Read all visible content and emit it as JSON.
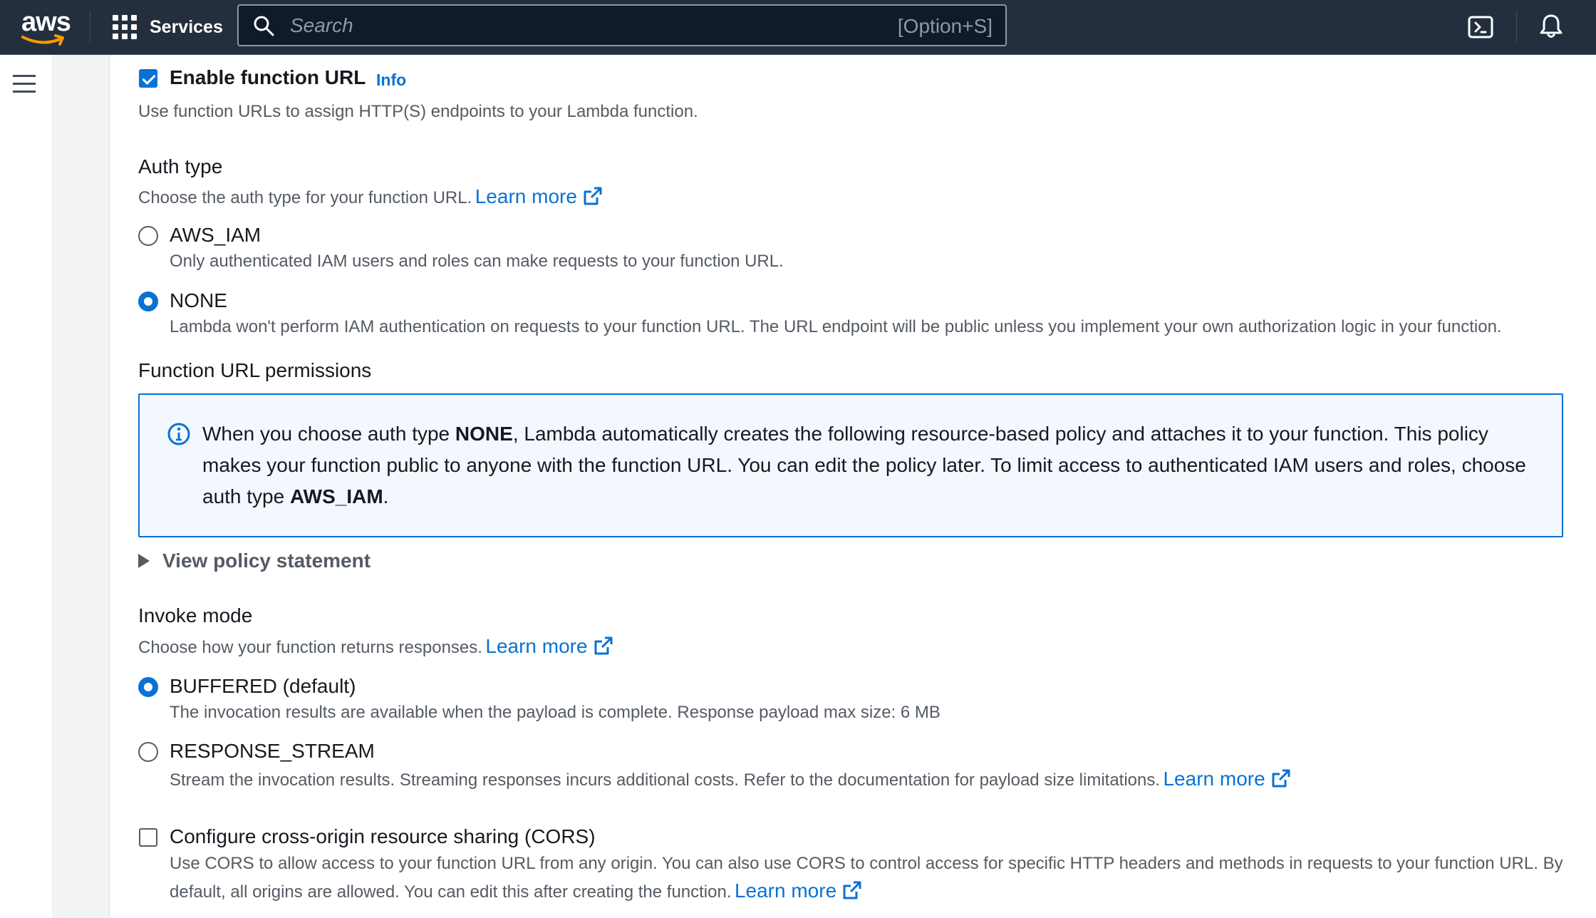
{
  "header": {
    "logo_text": "aws",
    "services_label": "Services",
    "search_placeholder": "Search",
    "search_shortcut": "[Option+S]"
  },
  "function_url": {
    "enable_label": "Enable function URL",
    "info_link": "Info",
    "enabled": true,
    "description": "Use function URLs to assign HTTP(S) endpoints to your Lambda function."
  },
  "auth_type": {
    "heading": "Auth type",
    "description": "Choose the auth type for your function URL.",
    "learn_more": "Learn more",
    "selected": "NONE",
    "options": [
      {
        "label": "AWS_IAM",
        "description": "Only authenticated IAM users and roles can make requests to your function URL."
      },
      {
        "label": "NONE",
        "description": "Lambda won't perform IAM authentication on requests to your function URL. The URL endpoint will be public unless you implement your own authorization logic in your function."
      }
    ]
  },
  "permissions": {
    "heading": "Function URL permissions",
    "info_part1": "When you choose auth type ",
    "info_bold1": "NONE",
    "info_part2": ", Lambda automatically creates the following resource-based policy and attaches it to your function. This policy makes your function public to anyone with the function URL. You can edit the policy later. To limit access to authenticated IAM users and roles, choose auth type ",
    "info_bold2": "AWS_IAM",
    "info_part3": ".",
    "view_policy": "View policy statement"
  },
  "invoke_mode": {
    "heading": "Invoke mode",
    "description": "Choose how your function returns responses.",
    "learn_more": "Learn more",
    "selected": "BUFFERED (default)",
    "options": [
      {
        "label": "BUFFERED (default)",
        "description": "The invocation results are available when the payload is complete. Response payload max size: 6 MB"
      },
      {
        "label": "RESPONSE_STREAM",
        "description": "Stream the invocation results. Streaming responses incurs additional costs. Refer to the documentation for payload size limitations.",
        "learn_more": "Learn more"
      }
    ]
  },
  "cors": {
    "label": "Configure cross-origin resource sharing (CORS)",
    "enabled": false,
    "description_line1": "Use CORS to allow access to your function URL from any origin. You can also use CORS to control access for specific HTTP headers and methods in requests to your function URL. By",
    "description_line2": "default, all origins are allowed. You can edit this after creating the function.",
    "learn_more": "Learn more"
  },
  "colors": {
    "nav_background": "#232f3e",
    "link": "#0972d3",
    "info_background": "#f2f8fd"
  }
}
